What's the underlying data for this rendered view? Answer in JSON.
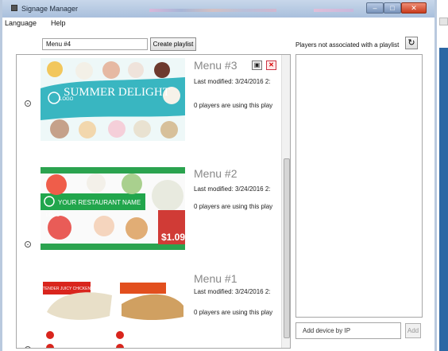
{
  "window": {
    "title": "Signage Manager"
  },
  "menu": [
    "Language",
    "Help"
  ],
  "toolbar": {
    "playlist_name": "Menu #4",
    "create_label": "Create playlist"
  },
  "playlists": [
    {
      "name": "Menu #3",
      "modified": "Last modified: 3/24/2016 2:",
      "players": "0 players are using this play",
      "thumb_text": "SUMMER DELIGHT",
      "logo": "LOGO"
    },
    {
      "name": "Menu #2",
      "modified": "Last modified: 3/24/2016 2:",
      "players": "0 players are using this play",
      "thumb_text": "YOUR RESTAURANT NAME",
      "logo": "LOGO",
      "price": "$1.09"
    },
    {
      "name": "Menu #1",
      "modified": "Last modified: 3/24/2016 2:",
      "players": "0 players are using this play",
      "thumb_text": "TENDER JUICY CHICKEN",
      "logo": ""
    }
  ],
  "right": {
    "title": "Players not associated with a playlist",
    "add_placeholder": "Add device by IP",
    "add_label": "Add"
  },
  "colors": {
    "accent": "#2c67a4",
    "menu3_bg": "#3bb8c2",
    "menu2_band": "#21a64c",
    "menu1_red": "#d9251d"
  },
  "icons": {
    "copy": "copy-icon",
    "delete": "delete-icon",
    "refresh": "refresh-icon",
    "expand": "chevron-down-icon"
  }
}
